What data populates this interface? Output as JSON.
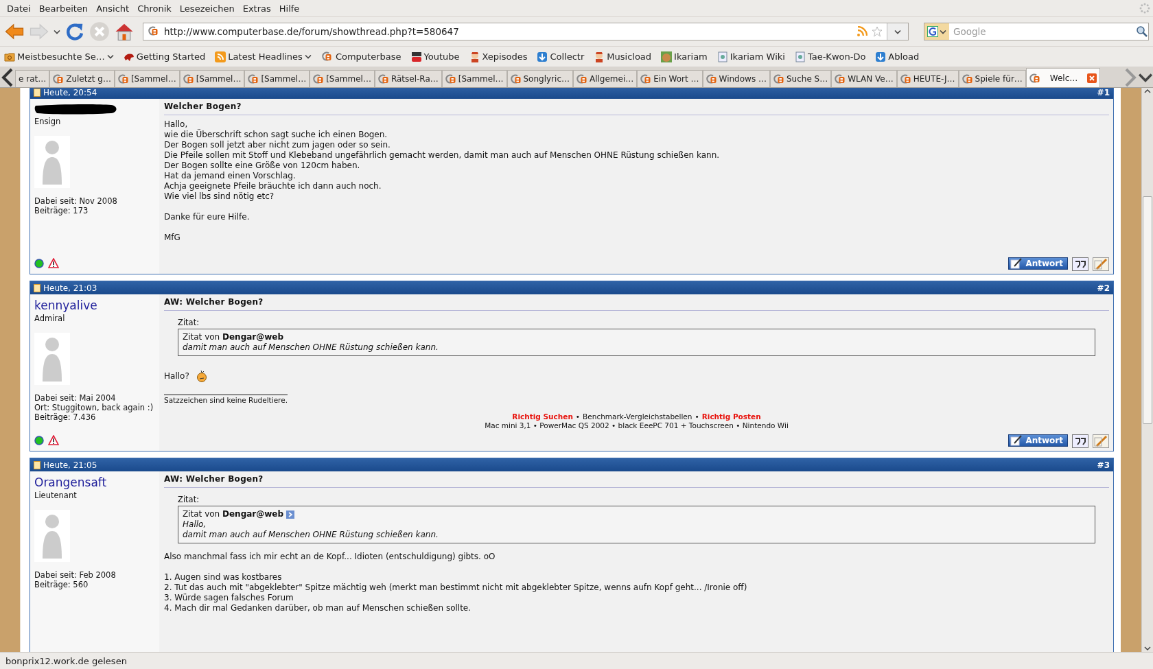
{
  "menu_bar": [
    "Datei",
    "Bearbeiten",
    "Ansicht",
    "Chronik",
    "Lesezeichen",
    "Extras",
    "Hilfe"
  ],
  "navigation": {
    "url": "http://www.computerbase.de/forum/showthread.php?t=580647",
    "search_placeholder": "Google"
  },
  "bookmarks": [
    {
      "label": "Meistbesuchte Se…",
      "kind": "folder",
      "has_menu": true
    },
    {
      "label": "Getting Started",
      "kind": "animal",
      "has_menu": false
    },
    {
      "label": "Latest Headlines",
      "kind": "feed",
      "has_menu": true
    },
    {
      "label": "Computerbase",
      "kind": "cb",
      "has_menu": false
    },
    {
      "label": "Youtube",
      "kind": "video",
      "has_menu": false
    },
    {
      "label": "Xepisodes",
      "kind": "figure",
      "has_menu": false
    },
    {
      "label": "Collectr",
      "kind": "arrow",
      "has_menu": false
    },
    {
      "label": "Musicload",
      "kind": "figure",
      "has_menu": false
    },
    {
      "label": "Ikariam",
      "kind": "face",
      "has_menu": false
    },
    {
      "label": "Ikariam Wiki",
      "kind": "page",
      "has_menu": false
    },
    {
      "label": "Tae-Kwon-Do",
      "kind": "page",
      "has_menu": false
    },
    {
      "label": "Abload",
      "kind": "arrow",
      "has_menu": false
    }
  ],
  "tabs": [
    {
      "label": "e rat…",
      "selected": false,
      "favicon": false
    },
    {
      "label": "Zuletzt g…",
      "selected": false,
      "favicon": true
    },
    {
      "label": "[Sammel…",
      "selected": false,
      "favicon": true
    },
    {
      "label": "[Sammel…",
      "selected": false,
      "favicon": true
    },
    {
      "label": "[Sammel…",
      "selected": false,
      "favicon": true
    },
    {
      "label": "[Sammel…",
      "selected": false,
      "favicon": true
    },
    {
      "label": "Rätsel-Ra…",
      "selected": false,
      "favicon": true
    },
    {
      "label": "[Sammel…",
      "selected": false,
      "favicon": true
    },
    {
      "label": "Songlyric…",
      "selected": false,
      "favicon": true
    },
    {
      "label": "Allgemei…",
      "selected": false,
      "favicon": true
    },
    {
      "label": "Ein Wort …",
      "selected": false,
      "favicon": true
    },
    {
      "label": "Windows …",
      "selected": false,
      "favicon": true
    },
    {
      "label": "Suche S…",
      "selected": false,
      "favicon": true
    },
    {
      "label": "WLAN Ve…",
      "selected": false,
      "favicon": true
    },
    {
      "label": "HEUTE-J…",
      "selected": false,
      "favicon": true
    },
    {
      "label": "Spiele für…",
      "selected": false,
      "favicon": true
    },
    {
      "label": "Welc…",
      "selected": true,
      "favicon": true
    }
  ],
  "posts": [
    {
      "date": "Heute, 20:54",
      "number": "#1",
      "author_redacted": true,
      "rank": "Ensign",
      "details": [
        "Dabei seit: Nov 2008",
        "Beiträge: 173"
      ],
      "title": "Welcher Bogen?",
      "paragraphs": [
        {
          "lines": [
            "Hallo,",
            "wie die Überschrift schon sagt suche ich einen Bogen.",
            "Der Bogen soll jetzt aber nicht zum jagen oder so sein.",
            "Die Pfeile sollen mit Stoff und Klebeband ungefährlich gemacht werden, damit man auch auf Menschen OHNE Rüstung schießen kann.",
            "Der Bogen sollte eine Größe von 120cm haben.",
            "Hat da jemand einen Vorschlag.",
            "Achja geeignete Pfeile bräuchte ich dann auch noch.",
            "Wie viel lbs sind nötig etc?"
          ],
          "smiley": false
        },
        {
          "lines": [
            "Danke für eure Hilfe."
          ],
          "smiley": false
        },
        {
          "lines": [
            "MfG"
          ],
          "smiley": false
        }
      ],
      "online": true,
      "reply_button": "Antwort"
    },
    {
      "date": "Heute, 21:03",
      "number": "#2",
      "author": "kennyalive",
      "author_redacted": false,
      "rank": "Admiral",
      "details": [
        "Dabei seit: Mai 2004",
        "Ort: Stuggitown, back again :)",
        "Beiträge: 7.436"
      ],
      "title": "AW: Welcher Bogen?",
      "quote": {
        "label": "Zitat:",
        "from": "Zitat von **Dengar@web**",
        "link": false,
        "lines": [
          "damit man auch auf Menschen OHNE Rüstung schießen kann."
        ]
      },
      "paragraphs": [
        {
          "lines": [
            "Hallo?"
          ],
          "smiley": true
        }
      ],
      "signature": {
        "text": "Satzzeichen sind keine Rudeltiere.",
        "separator": "•",
        "links": [
          {
            "text": "Richtig Suchen",
            "kind": "link"
          },
          {
            "text": "Benchmark-Vergleichstabellen",
            "kind": "plain"
          },
          {
            "text": "Richtig Posten",
            "kind": "link"
          }
        ],
        "devices": "Mac mini 3,1 • PowerMac QS 2002 • black EeePC 701 + Touchscreen • Nintendo Wii"
      },
      "online": true,
      "reply_button": "Antwort"
    },
    {
      "date": "Heute, 21:05",
      "number": "#3",
      "author": "Orangensaft",
      "author_redacted": false,
      "rank": "Lieutenant",
      "details": [
        "Dabei seit: Feb 2008",
        "Beiträge: 560"
      ],
      "title": "AW: Welcher Bogen?",
      "quote": {
        "label": "Zitat:",
        "from": "Zitat von **Dengar@web**",
        "link": true,
        "lines": [
          "Hallo,",
          "damit man auch auf Menschen OHNE Rüstung schießen kann."
        ]
      },
      "paragraphs": [
        {
          "lines": [
            "Also manchmal fass ich mir echt an de Kopf... Idioten (entschuldigung) gibts. oO"
          ],
          "smiley": false
        },
        {
          "lines": [
            "1. Augen sind was kostbares",
            "2. Tut das auch mit \"abgeklebter\" Spitze mächtig weh (merkt man bestimmt nicht mit abgeklebter Spitze, wenns aufn Kopf geht... /Ironie off)",
            "3. Würde sagen falsches Forum",
            "4. Mach dir mal Gedanken darüber, ob man auf Menschen schießen sollte."
          ],
          "smiley": false
        }
      ]
    }
  ],
  "status_bar": "bonprix12.work.de gelesen"
}
